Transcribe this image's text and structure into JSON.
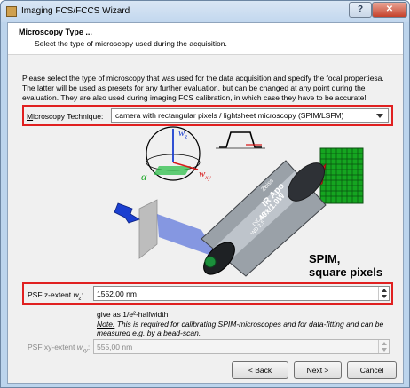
{
  "window": {
    "title": "Imaging FCS/FCCS Wizard",
    "help_label": "?",
    "close_label": "✕"
  },
  "header": {
    "title": "Microscopy Type ...",
    "subtitle": "Select the type of microscopy used during the acquisition."
  },
  "intro": {
    "line1": "Please select the type of microscopy that was used for the data acquisition and specify the focal propertiesa.",
    "line2": "The latter will be used as presets for any further evaluation, but can be changed at any point during the",
    "line3": "evaluation. They are also used during imaging FCS calibration, in which case they have to be accurate!"
  },
  "microscopy": {
    "label": "Microscopy Technique:",
    "value": "camera with rectangular pixels / lightsheet microscopy (SPIM/LSFM)"
  },
  "illustration": {
    "caption_line1": "SPIM,",
    "caption_line2": "square pixels",
    "axis_z": "w",
    "axis_z_sub": "z",
    "axis_xy": "w",
    "axis_xy_sub": "xy",
    "angle": "α",
    "objective_text1": "Zeiss",
    "objective_text2": "IR Apo",
    "objective_text3": "40x/1.0W",
    "objective_text4": "DIC M27",
    "objective_text5": "WD 2.5",
    "colors": {
      "laser": "#1b3fd0",
      "emission": "#d81a1a",
      "pixel_grid": "#15a520",
      "pixel_grid_line": "#0a5010"
    }
  },
  "psf_z": {
    "label": "PSF z-extent",
    "symbol": "wz",
    "suffix": ":",
    "value": "1552,00 nm"
  },
  "note": {
    "line1": "give as 1/e²-halfwidth",
    "note_label": "Note:",
    "line2": " This is required for calibrating SPIM-microscopes and for data-fitting and can be",
    "line3": "measured e.g. by a bead-scan."
  },
  "psf_xy": {
    "label": "PSF xy-extent",
    "symbol": "wxy",
    "suffix": ":",
    "value": "555,00 nm"
  },
  "buttons": {
    "back": "< Back",
    "next": "Next >",
    "cancel": "Cancel"
  },
  "accent": {
    "highlight": "#e02020"
  }
}
